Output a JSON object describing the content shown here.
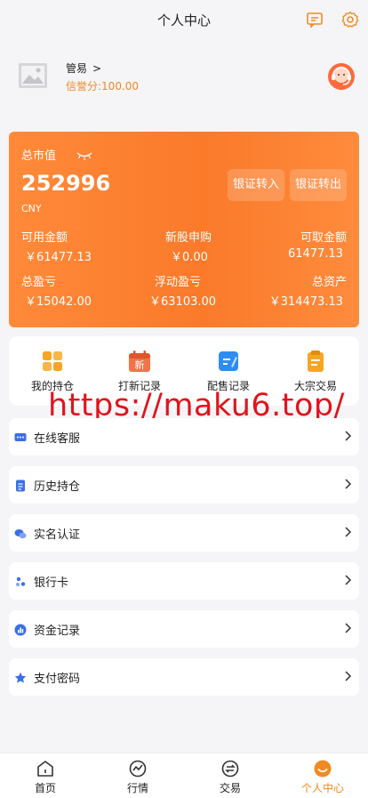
{
  "header": {
    "title": "个人中心",
    "message_icon": "message-icon",
    "settings_icon": "gear-icon"
  },
  "user": {
    "name": "管易",
    "name_chevron": ">",
    "credit_text": "信誉分:100.00",
    "avatar_icon": "image-placeholder-icon",
    "service_icon": "customer-service-icon"
  },
  "asset_card": {
    "label": "总市值",
    "value": "252996",
    "currency": "CNY",
    "buttons": {
      "transfer_in": "银证转入",
      "transfer_out": "银证转出"
    },
    "stats_row1": {
      "available_label": "可用金额",
      "available_value": "￥61477.13",
      "ipo_label": "新股申购",
      "ipo_value": "￥0.00",
      "withdrawable_label": "可取金额",
      "withdrawable_value": "61477.13"
    },
    "stats_row2": {
      "total_pl_label": "总盈亏",
      "total_pl_value": "￥15042.00",
      "floating_pl_label": "浮动盈亏",
      "floating_pl_value": "￥63103.00",
      "total_assets_label": "总资产",
      "total_assets_value": "￥314473.13"
    }
  },
  "quick_actions": [
    {
      "label": "我的持仓",
      "icon": "grid-icon"
    },
    {
      "label": "打新记录",
      "icon": "new-calendar-icon"
    },
    {
      "label": "配售记录",
      "icon": "edit-note-icon"
    },
    {
      "label": "大宗交易",
      "icon": "clipboard-icon"
    }
  ],
  "watermark": "https://maku6.top/",
  "menu": [
    {
      "label": "在线客服",
      "icon": "chat-icon"
    },
    {
      "label": "历史持仓",
      "icon": "document-icon"
    },
    {
      "label": "实名认证",
      "icon": "bubbles-icon"
    },
    {
      "label": "银行卡",
      "icon": "card-dots-icon"
    },
    {
      "label": "资金记录",
      "icon": "fund-icon"
    },
    {
      "label": "支付密码",
      "icon": "star-icon"
    }
  ],
  "tabbar": [
    {
      "label": "首页",
      "icon": "home-icon"
    },
    {
      "label": "行情",
      "icon": "market-icon"
    },
    {
      "label": "交易",
      "icon": "trade-icon"
    },
    {
      "label": "个人中心",
      "icon": "profile-icon"
    }
  ],
  "colors": {
    "accent": "#f08a24",
    "card_gradient_start": "#ff8a3a",
    "card_gradient_end": "#fa7a2a",
    "watermark": "#e0141c",
    "background": "#f5f5f7"
  }
}
